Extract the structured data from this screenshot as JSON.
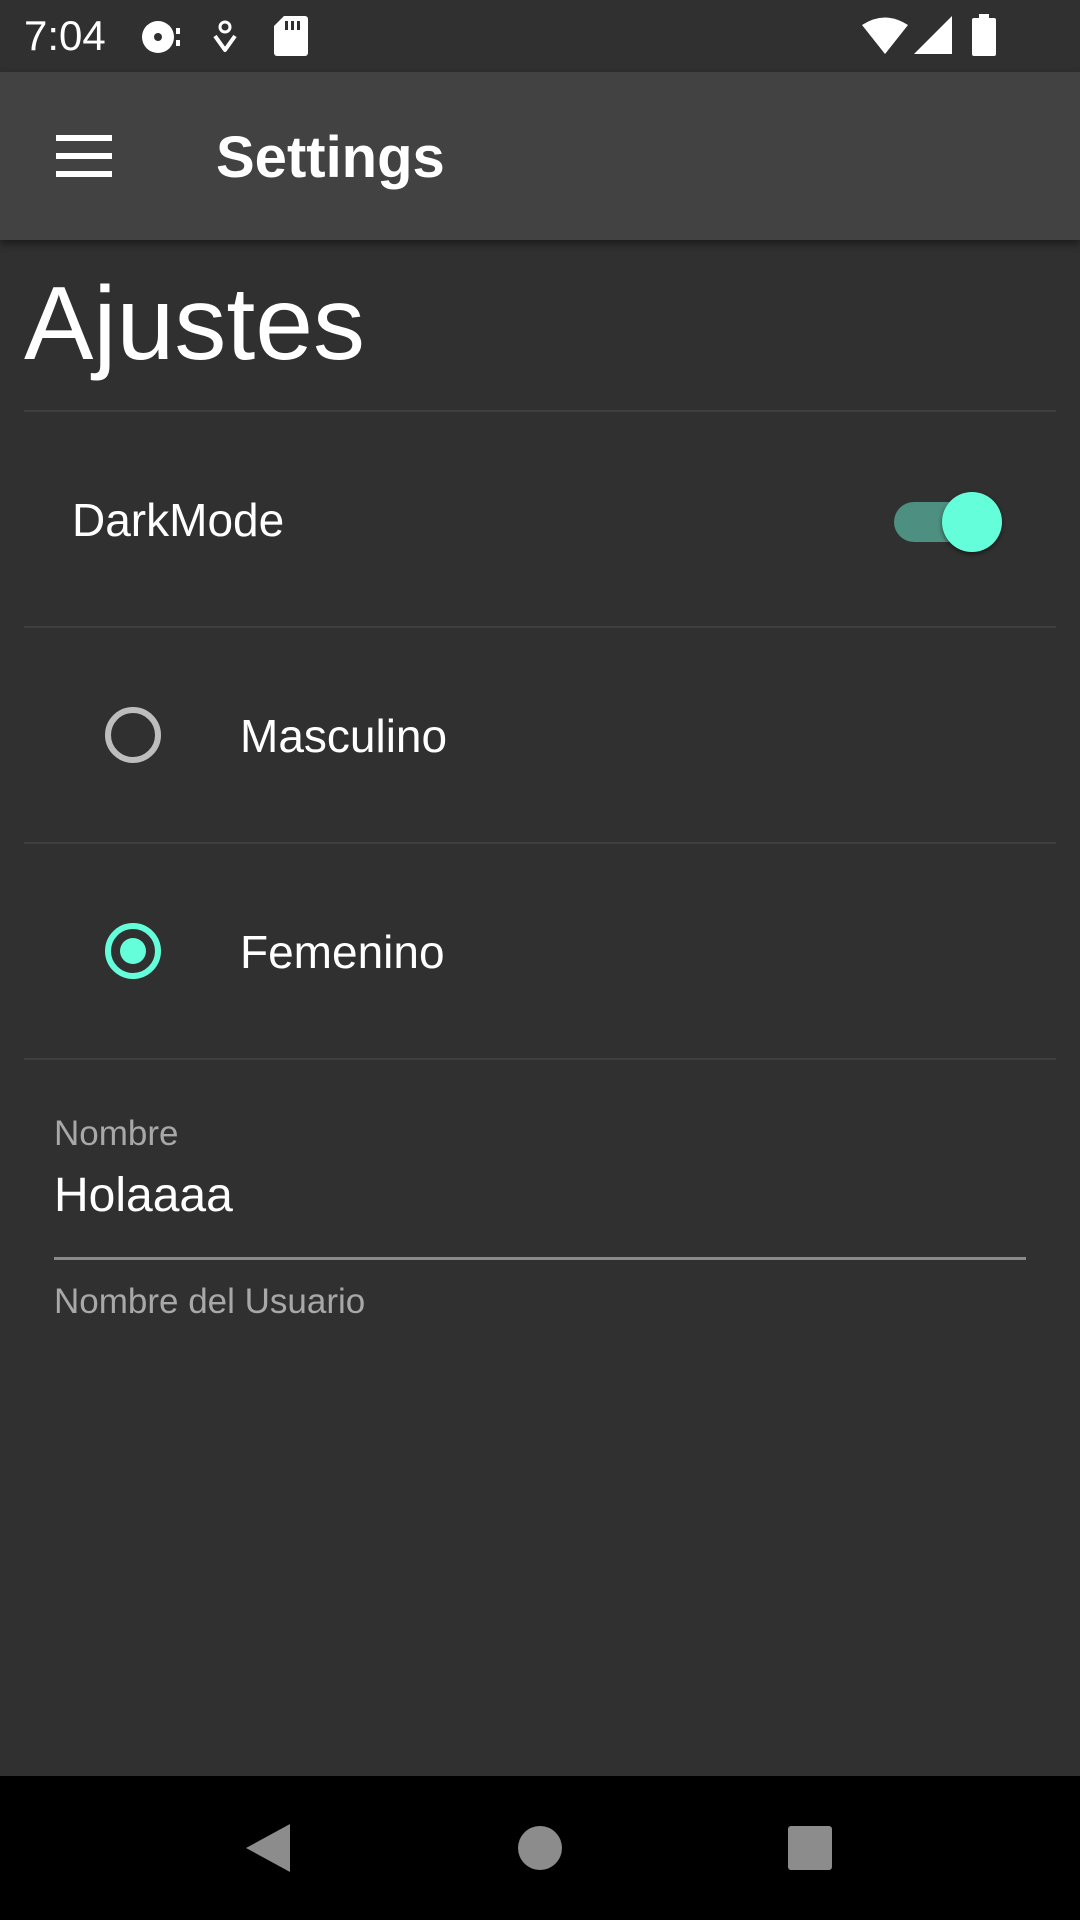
{
  "status_bar": {
    "time": "7:04",
    "left_icons": [
      "media-icon",
      "location-icon",
      "sd-card-icon"
    ],
    "right_icons": [
      "wifi-icon",
      "signal-icon",
      "battery-icon"
    ]
  },
  "app_bar": {
    "menu_icon": "menu-icon",
    "title": "Settings"
  },
  "page": {
    "heading": "Ajustes"
  },
  "preferences": {
    "dark_mode": {
      "label": "DarkMode",
      "enabled": true
    },
    "gender": {
      "options": [
        {
          "label": "Masculino",
          "selected": false
        },
        {
          "label": "Femenino",
          "selected": true
        }
      ]
    },
    "name": {
      "label": "Nombre",
      "value": "Holaaaa",
      "helper": "Nombre del Usuario"
    }
  },
  "nav_bar": {
    "buttons": [
      "back-icon",
      "home-icon",
      "recents-icon"
    ]
  },
  "colors": {
    "background": "#303030",
    "app_bar": "#424242",
    "accent": "#64ffda",
    "switch_track": "#4d8f80",
    "text_primary": "#ffffff",
    "text_secondary": "#a8a8a8"
  }
}
